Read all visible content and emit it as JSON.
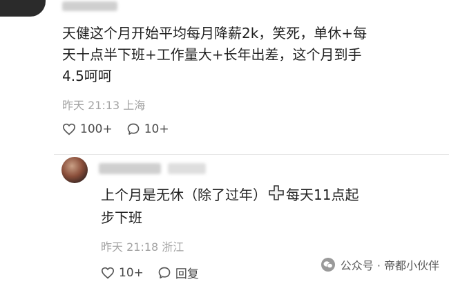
{
  "comment": {
    "text_line1": "天健这个月开始平均每月降薪2k，笑死，单休+每",
    "text_line2": "天十点半下班+工作量大+长年出差，这个月到手",
    "text_line3": "4.5呵呵",
    "meta": "昨天 21:13 上海",
    "like_count": "100+",
    "reply_count": "10+"
  },
  "reply": {
    "text_line1_a": "上个月是无休（除了过年）",
    "text_line1_b": "每天11点起",
    "text_line2": "步下班",
    "meta": "昨天 21:18 浙江",
    "like_count": "10+",
    "reply_label": "回复",
    "inline_icon": "plus-cross-icon"
  },
  "watermark": {
    "text": "公众号 · 帝都小伙伴",
    "icon": "wechat-icon"
  },
  "icons": {
    "like": "heart-icon",
    "comment": "speech-bubble-icon"
  }
}
